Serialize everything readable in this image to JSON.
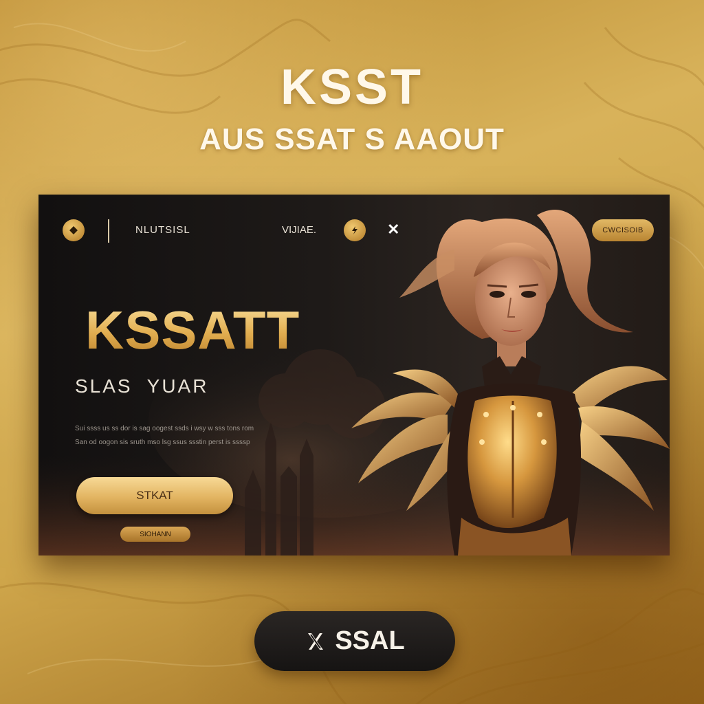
{
  "header": {
    "title": "KSST",
    "subtitle": "AUS SSAT S AAOUT"
  },
  "panel": {
    "nav": {
      "logo_icon": "diamond-icon",
      "brand": "NLUTSISL",
      "link": "VIJIAE.",
      "action_icon": "lightning-icon",
      "close_icon": "close-icon",
      "pill_label": "CWCISOIB"
    },
    "title": "KSSATT",
    "subtitle": "SLAS  YUAR",
    "description": [
      "Sui ssss us ss dor is sag oogest ssds i wsy w sss tons rom",
      "San od oogon sis sruth mso lsg ssus ssstin perst is ssssp"
    ],
    "primary_button": "STKAT",
    "secondary_button": "SIOHANN"
  },
  "bottom_button": {
    "icon": "x-logo-icon",
    "label": "SSAL"
  },
  "colors": {
    "background_gold": "#cfa64b",
    "panel_dark": "#1e1a18",
    "accent_gold": "#e2b461",
    "bottom_button_dark": "#1c1918"
  }
}
